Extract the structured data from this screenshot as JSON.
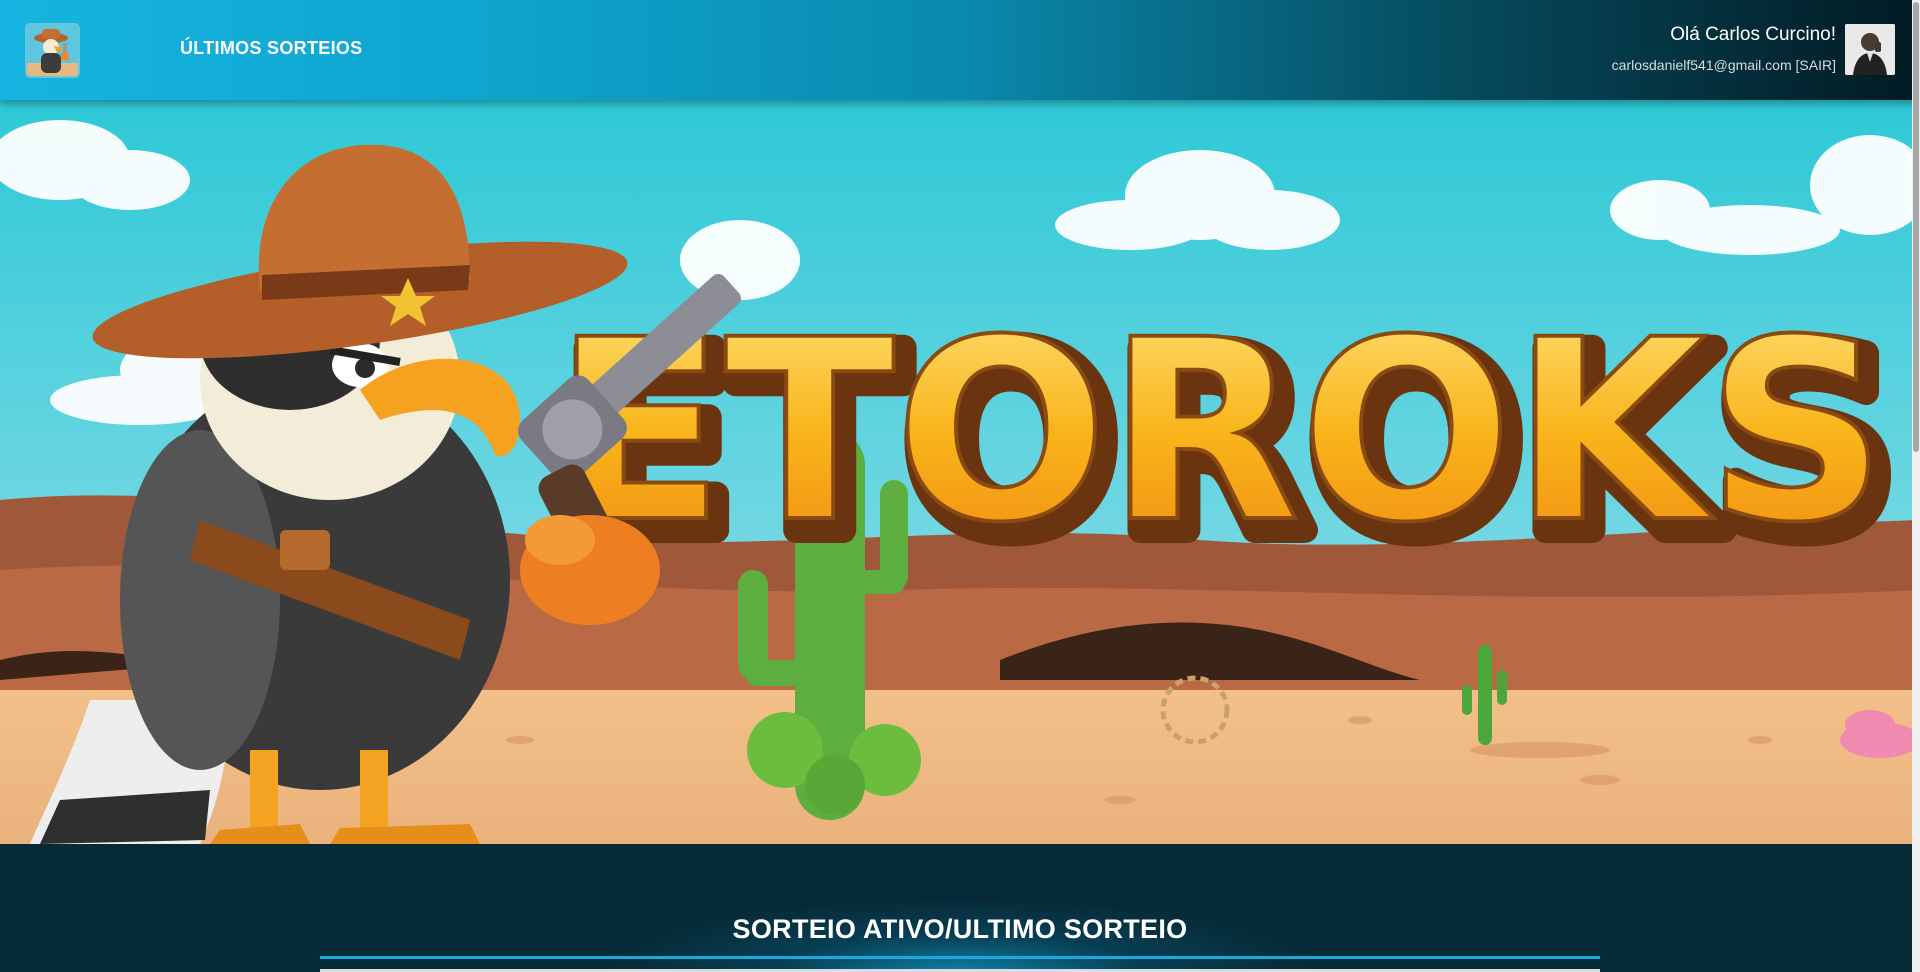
{
  "header": {
    "nav_label": "ÚLTIMOS SORTEIOS",
    "greeting": "Olá Carlos Curcino!",
    "email": "carlosdanielf541@gmail.com",
    "logout_label": "[SAIR]"
  },
  "banner": {
    "title": "ETOROKS"
  },
  "section": {
    "title": "SORTEIO ATIVO/ULTIMO SORTEIO"
  },
  "colors": {
    "header_start": "#16b4e0",
    "header_end": "#021a22",
    "page_bg": "#062a36",
    "accent_line": "#1aa9dc",
    "banner_title": "#f7b21a"
  },
  "icons": {
    "logo": "eagle-cowboy-logo-icon",
    "avatar": "user-avatar-icon"
  }
}
